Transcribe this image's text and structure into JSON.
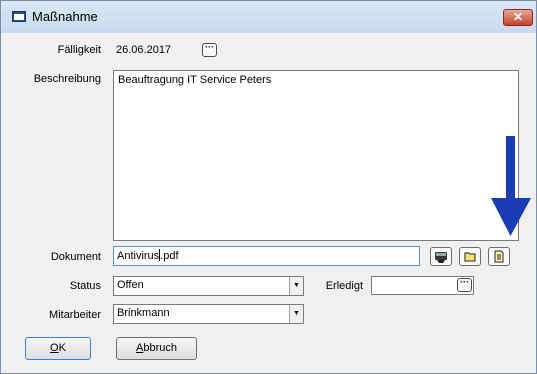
{
  "window": {
    "title": "Maßnahme",
    "close_glyph": "✕"
  },
  "form": {
    "faelligkeit": {
      "label": "Fälligkeit",
      "value": "26.06.2017"
    },
    "beschreibung": {
      "label": "Beschreibung",
      "value": "Beauftragung IT Service Peters"
    },
    "dokument": {
      "label": "Dokument",
      "value_before_caret": "Antivirus",
      "value_after_caret": ".pdf"
    },
    "status": {
      "label": "Status",
      "value": "Offen"
    },
    "erledigt": {
      "label": "Erledigt",
      "value": ""
    },
    "mitarbeiter": {
      "label": "Mitarbeiter",
      "value": "Brinkmann"
    }
  },
  "buttons": {
    "ok": "OK",
    "abbruch": "Abbruch",
    "ok_mnemonic": "O",
    "abbruch_mnemonic": "A"
  },
  "icons": {
    "date_picker": "dots-icon",
    "scan": "scanner-icon",
    "open_folder": "folder-icon",
    "open_document": "document-icon",
    "combo": "dropdown-arrow-icon",
    "annotation": "blue-down-arrow-icon"
  },
  "colors": {
    "annotation_arrow": "#1a3db5",
    "close_button": "#c6432b"
  }
}
